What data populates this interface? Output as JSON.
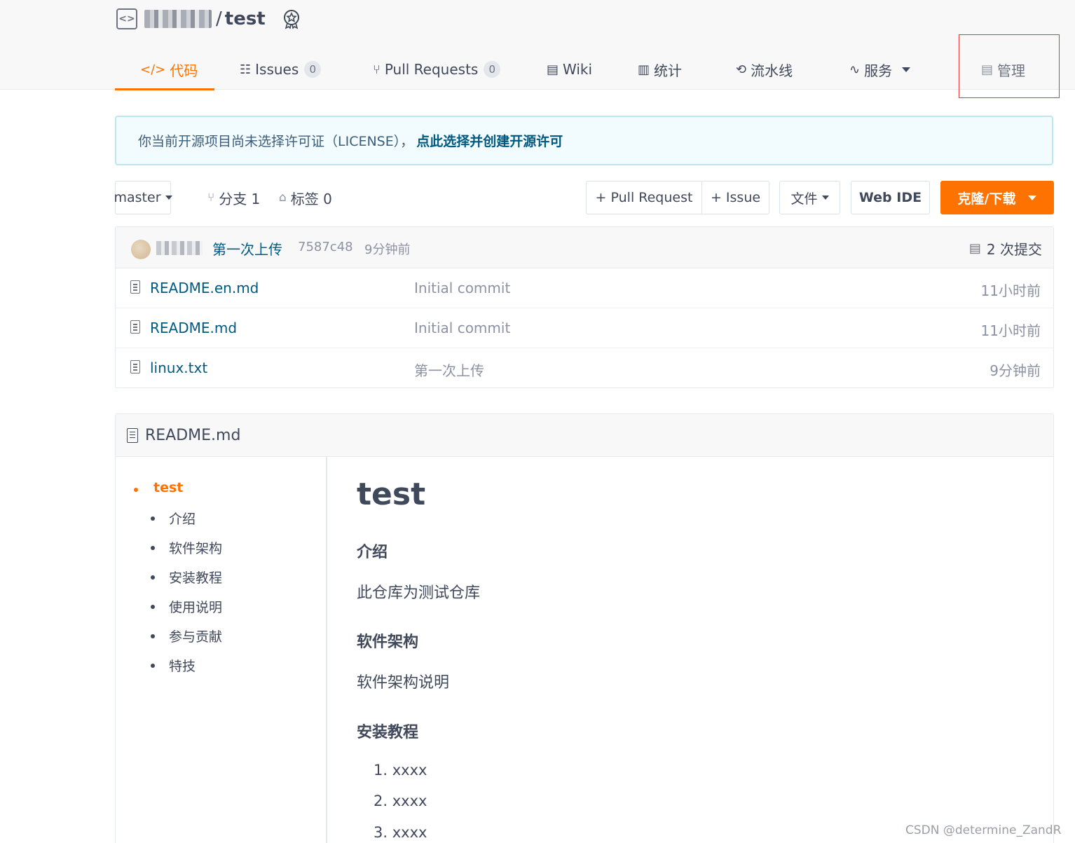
{
  "repo": {
    "separator": "/",
    "name": "test"
  },
  "tabs": [
    {
      "label": "代码"
    },
    {
      "label": "Issues",
      "count": "0"
    },
    {
      "label": "Pull Requests",
      "count": "0"
    },
    {
      "label": "Wiki"
    },
    {
      "label": "统计"
    },
    {
      "label": "流水线"
    },
    {
      "label": "服务"
    },
    {
      "label": "管理"
    }
  ],
  "notice": {
    "text": "你当前开源项目尚未选择许可证（LICENSE），",
    "link": "点此选择并创建开源许可"
  },
  "toolbar": {
    "branch": "master",
    "branches_label": "分支 1",
    "tags_label": "标签 0",
    "pull_request": "+ Pull Request",
    "issue": "+ Issue",
    "files": "文件",
    "web_ide": "Web IDE",
    "clone": "克隆/下载"
  },
  "commit": {
    "message": "第一次上传",
    "sha": "7587c48",
    "time": "9分钟前",
    "count": "2 次提交"
  },
  "files": [
    {
      "name": "README.en.md",
      "message": "Initial commit",
      "time": "11小时前"
    },
    {
      "name": "README.md",
      "message": "Initial commit",
      "time": "11小时前"
    },
    {
      "name": "linux.txt",
      "message": "第一次上传",
      "time": "9分钟前"
    }
  ],
  "readme": {
    "title": "README.md",
    "toc": [
      "test",
      "介绍",
      "软件架构",
      "安装教程",
      "使用说明",
      "参与贡献",
      "特技"
    ],
    "h1": "test",
    "sections": [
      {
        "heading": "介绍",
        "body": "此仓库为测试仓库"
      },
      {
        "heading": "软件架构",
        "body": "软件架构说明"
      },
      {
        "heading": "安装教程"
      }
    ],
    "install_steps": [
      "1. xxxx",
      "2. xxxx",
      "3. xxxx"
    ]
  },
  "watermark": "CSDN @determine_ZandR",
  "colors": {
    "accent": "#fe7300",
    "link": "#005980",
    "notice_bg": "#f2fbfd",
    "highlight_box": "#e03a3a"
  }
}
